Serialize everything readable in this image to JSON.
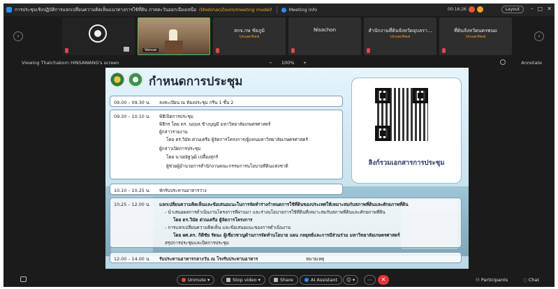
{
  "app": {
    "title": "การประชุมเชิงปฏิบัติการแลกเปลี่ยนความคิดเห็นแนวทางการใช้ที่ดิน ภาคตะวันออกเฉียงเหนือ ร...",
    "edition": "(Webinar/Zoom/meeting model)",
    "meeting_info": "Meeting info",
    "time": "00:16:26",
    "layout_label": "Layout",
    "minimize": "–",
    "maximize": "□",
    "close": "✕"
  },
  "participants_strip": [
    {
      "name": "",
      "status": "",
      "kind": "logo"
    },
    {
      "name": "",
      "status": "",
      "tag": "Venue",
      "kind": "live"
    },
    {
      "name": "สกจ.กษ ขัยภูมิ",
      "status": "Unverified",
      "kind": "name"
    },
    {
      "name": "Nisachon",
      "status": "",
      "kind": "name"
    },
    {
      "name": "สำนักงานที่ดินจังหวัดอุบลรา...",
      "status": "Unverified",
      "kind": "name"
    },
    {
      "name": "ที่ดินจังหวัดนครพนม",
      "status": "Unverified",
      "kind": "name"
    }
  ],
  "viewbar": {
    "viewing": "Viewing Thatchakorn HINSAWANG's screen",
    "zoom": "100%",
    "zoom_minus": "−",
    "zoom_plus": "+",
    "annotate": "Annotate"
  },
  "slide": {
    "title": "กำหนดการประชุม",
    "qr_label": "ลิงก์รวมเอกสารการประชุม",
    "items": [
      {
        "time": "09.00 – 09.30 น.",
        "text": "ลงทะเบียน ณ ห้องประชุม กรีน 1 ชั้น 2"
      },
      {
        "time": "09.30 – 10.10 น.",
        "text": "พิธีเปิดการประชุม"
      },
      {
        "time": "",
        "text": "พิธีกร  โดย ดร. นฤมล ช้างบุญมี   มหาวิทยาลัยเกษตรศาสตร์"
      },
      {
        "time": "",
        "text": "ผู้กล่าวรายงาน"
      },
      {
        "time": "",
        "text": "โดย ดร.วิมัต ต่วนเครือ      ผู้จัดการโครงการ/ผู้แทนมหาวิทยาลัยเกษตรศาสตร์"
      },
      {
        "time": "",
        "text": "ผู้กล่าวเปิดการประชุม"
      },
      {
        "time": "",
        "text": "โดย นายณัฐวุฒิ เปลื้องสุกร์"
      },
      {
        "time": "",
        "text": "ผู้ช่วยผู้อำนวยการสำนักงานคณะกรรมการนโยบายที่ดินแห่งชาติ"
      },
      {
        "time": "10.10 – 10.25 น.",
        "text": "พักรับประทานอาหารว่าง"
      },
      {
        "time": "10.25 – 12.00 น.",
        "text": "แลกเปลี่ยนความคิดเห็นและข้อเสนอแนะในการจัดทำร่างกำหนดการใช้ที่ดินของประเทศให้เหมาะสมกับสภาพที่ดินและศักยภาพที่ดิน"
      },
      {
        "time": "",
        "text": "- นำเสนอผลการดำเนินงานโครงการที่ผ่านมา และร่างนโยบายการใช้ที่ดินที่เหมาะสมกับสภาพที่ดินและศักยภาพที่ดิน"
      },
      {
        "time": "",
        "text": "โดย ดร.วิมัต ต่วนเครือ ผู้จัดการโครงการ"
      },
      {
        "time": "",
        "text": "- การแลกเปลี่ยนความคิดเห็น และข้อเสนอแนะของการดำเนินงาน"
      },
      {
        "time": "",
        "text": "โดย ผศ.ดร. กิติชัย รัตนะ ผู้เชี่ยวชาญด้านการจัดทำนโยบาย แผน กลยุทธ์และการมีส่วนร่วม มหาวิทยาลัยเกษตรศาสตร์"
      },
      {
        "time": "",
        "text": "สรุปการประชุมและปิดการประชุม"
      },
      {
        "time": "12.00 – 14.00 น.",
        "text": "รับประทานอาหารกลางวัน ณ โรงรับประทานอาหาร"
      },
      {
        "time": "",
        "text": "หมายเหตุ"
      }
    ]
  },
  "toolbar": {
    "unmute": "Unmute",
    "stop_video": "Stop video",
    "share": "Share",
    "ai_assistant": "AI Assistant",
    "participants": "Participants",
    "chat": "Chat"
  },
  "colors": {
    "accent": "#2d8cff",
    "end_call": "#e0333e",
    "unverified": "#f5a623"
  }
}
